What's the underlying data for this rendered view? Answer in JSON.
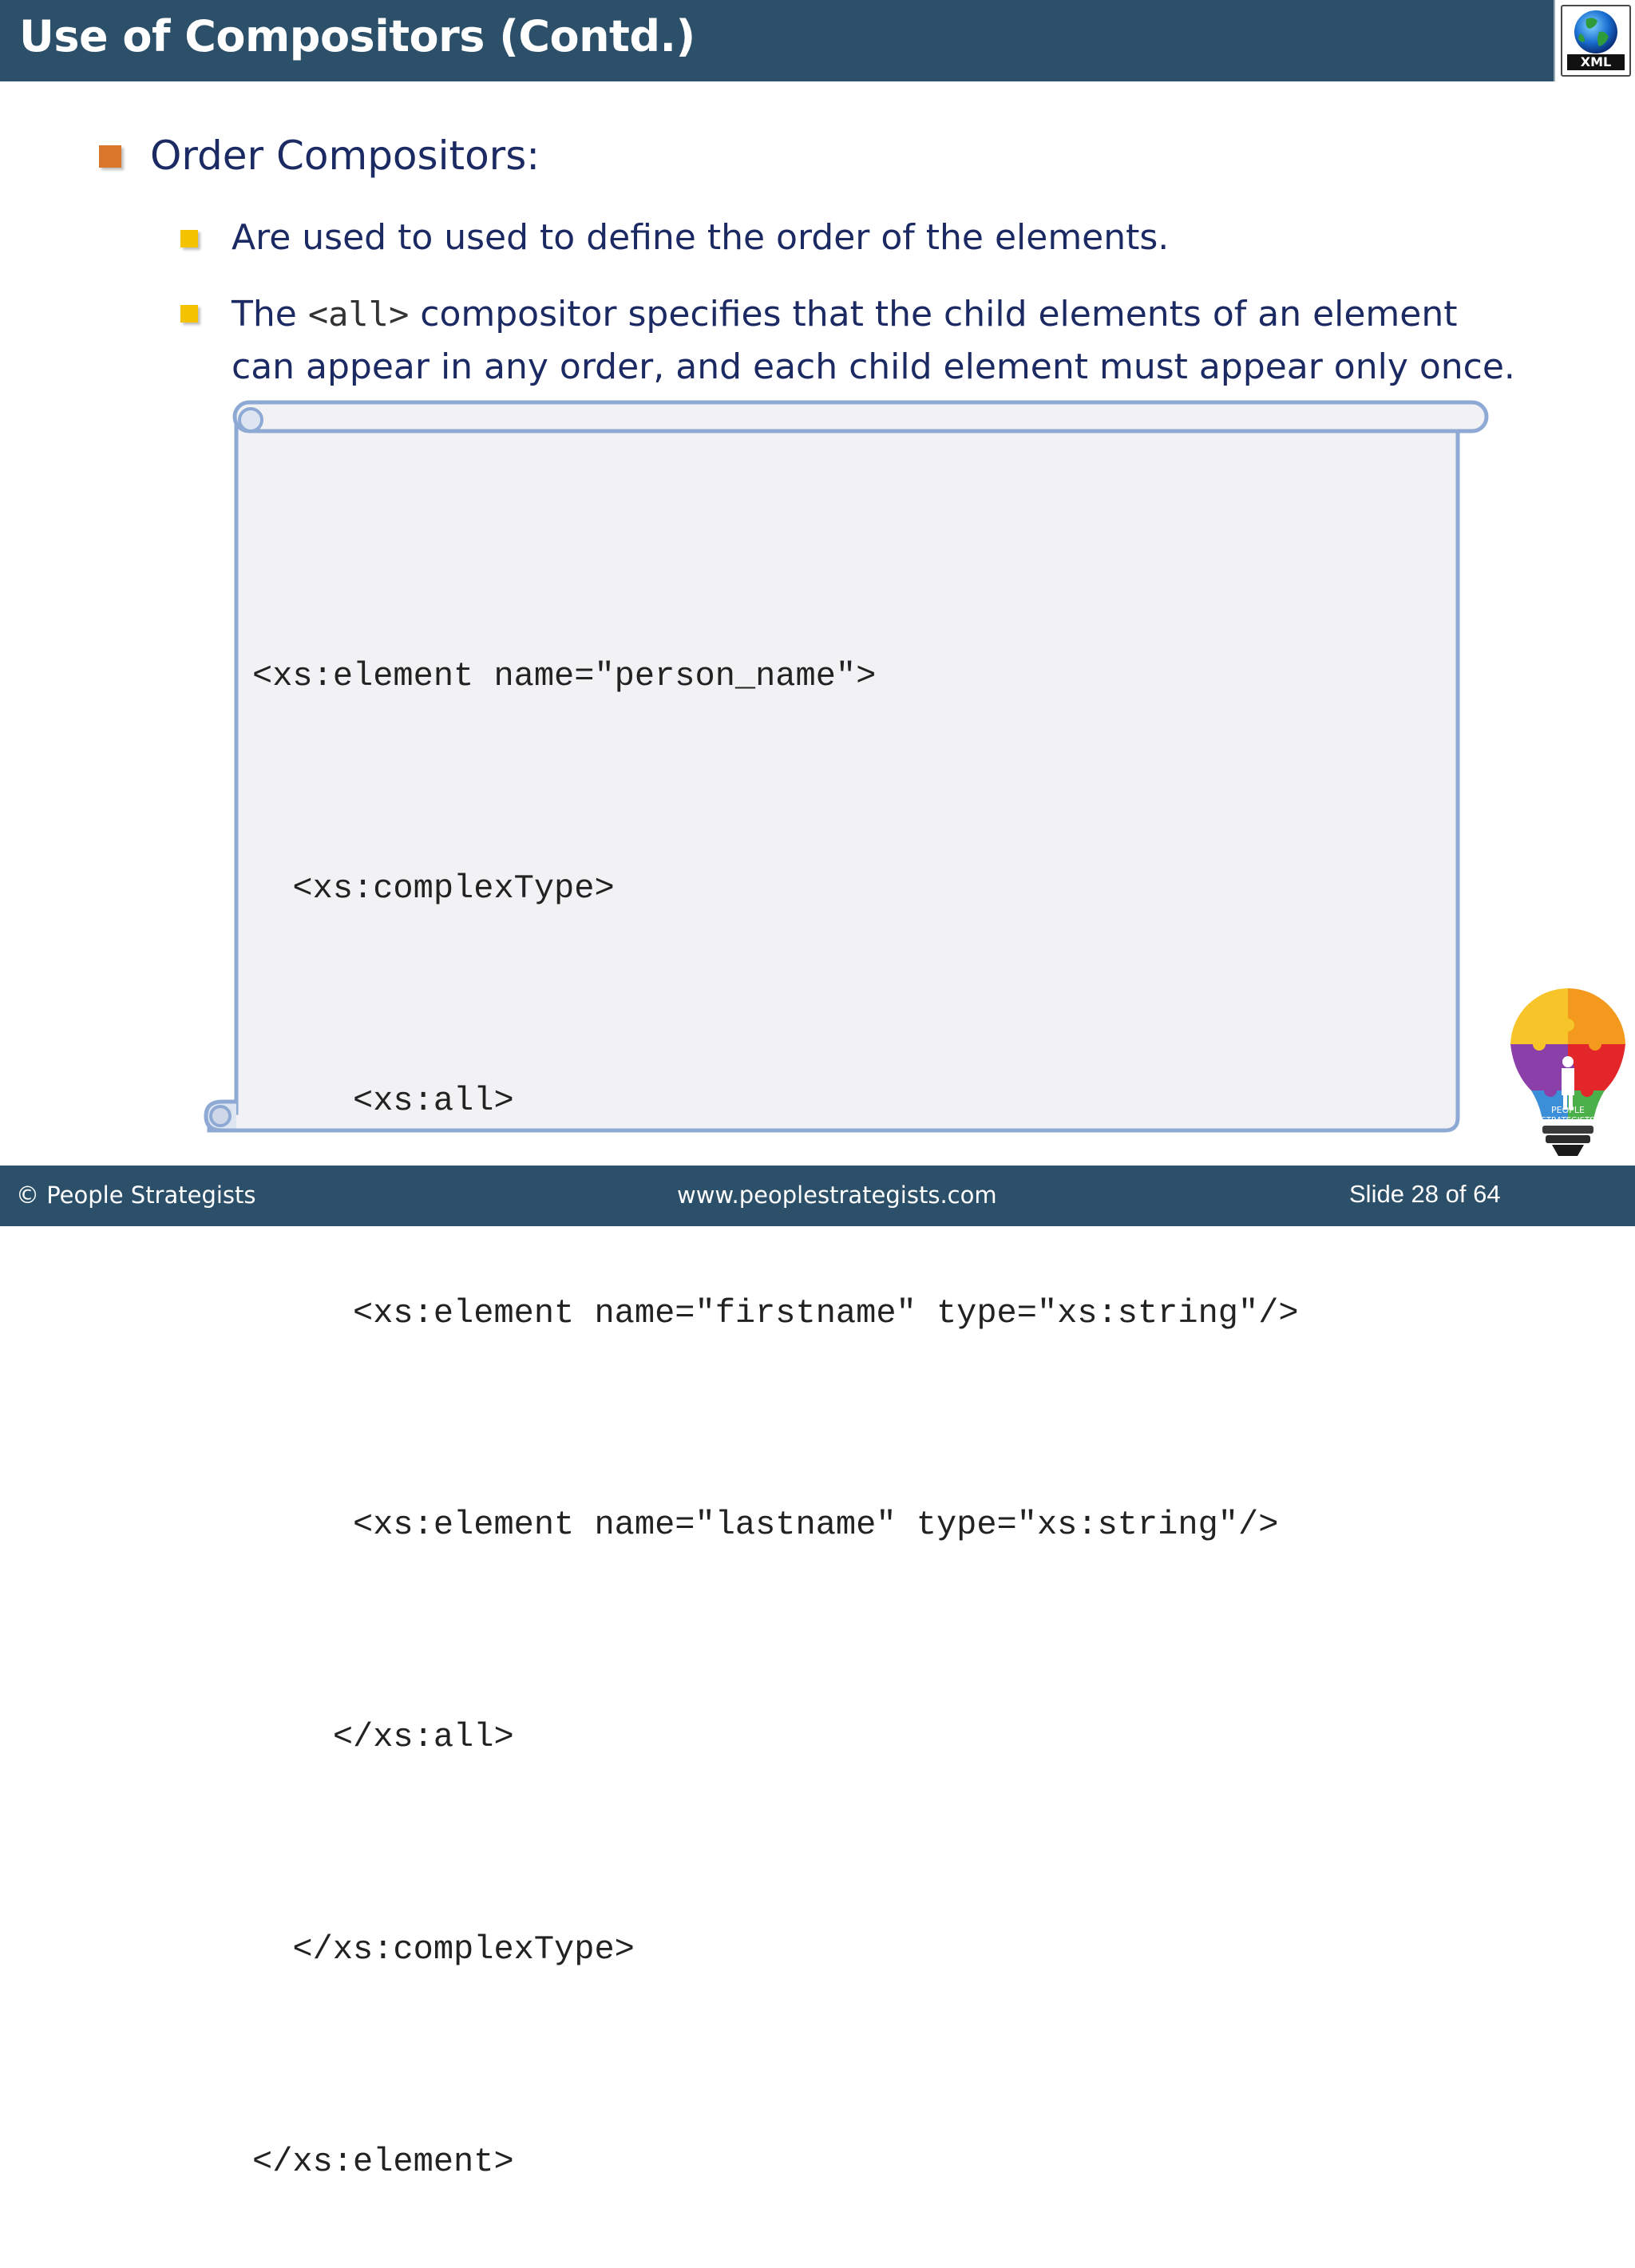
{
  "header": {
    "title": "Use of Compositors (Contd.)",
    "logo_label": "XML"
  },
  "content": {
    "main_bullet": "Order Compositors:",
    "sub_bullet_1": "Are used to used to define the order of the elements.",
    "sub_bullet_2": {
      "before": "The ",
      "code": "<all>",
      "after_line1": " compositor specifies that the child elements of an element",
      "line2": "can appear in any order, and each child element must appear only once."
    }
  },
  "code_block": {
    "lines": [
      "",
      "<xs:element name=\"person_name\">",
      "  <xs:complexType>",
      "     <xs:all>",
      "     <xs:element name=\"firstname\" type=\"xs:string\"/>",
      "     <xs:element name=\"lastname\" type=\"xs:string\"/>",
      "    </xs:all>",
      "  </xs:complexType>",
      "</xs:element>"
    ]
  },
  "footer": {
    "copyright": "© People Strategists",
    "website": "www.peoplestrategists.com",
    "slide_number": "Slide 28 of 64"
  },
  "bulb_logo_text": [
    "PEOPLE",
    "STRATEGISTS"
  ],
  "colors": {
    "header_bg": "#2c5069",
    "title_text": "#ffffff",
    "body_text": "#1b2a63",
    "bullet_l1": "#d9782d",
    "bullet_l2": "#f5c200",
    "scroll_border": "#8eaad4",
    "scroll_fill": "#f2f2f4"
  }
}
